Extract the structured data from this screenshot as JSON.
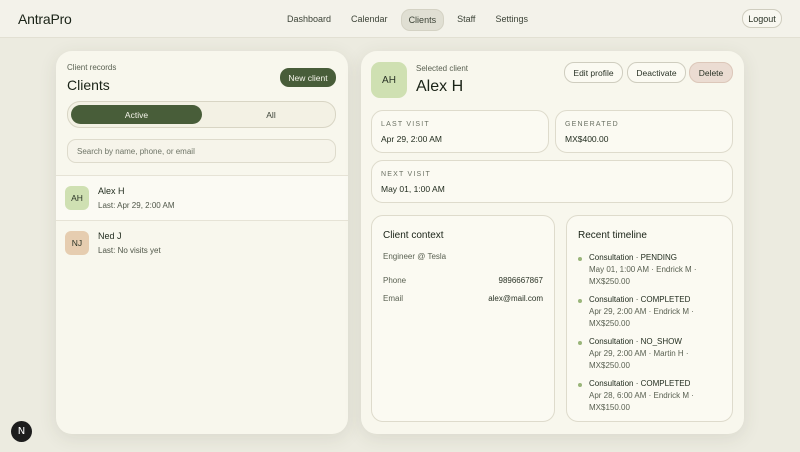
{
  "app": {
    "brand": "AntraPro"
  },
  "nav": {
    "items": [
      {
        "label": "Dashboard"
      },
      {
        "label": "Calendar"
      },
      {
        "label": "Clients",
        "active": true
      },
      {
        "label": "Staff"
      },
      {
        "label": "Settings"
      }
    ],
    "logout": "Logout"
  },
  "list": {
    "eyebrow": "Client records",
    "title": "Clients",
    "new_button": "New client",
    "tabs": {
      "active": "Active",
      "all": "All"
    },
    "search_placeholder": "Search by name, phone, or email",
    "clients": [
      {
        "initials": "AH",
        "name": "Alex H",
        "last": "Last: Apr 29, 2:00 AM"
      },
      {
        "initials": "NJ",
        "name": "Ned J",
        "last": "Last: No visits yet"
      }
    ]
  },
  "detail": {
    "initials": "AH",
    "eyebrow": "Selected client",
    "name": "Alex H",
    "actions": {
      "edit": "Edit profile",
      "deactivate": "Deactivate",
      "delete": "Delete"
    },
    "stats": {
      "last_visit": {
        "label": "LAST VISIT",
        "value": "Apr 29, 2:00 AM"
      },
      "generated": {
        "label": "GENERATED",
        "value": "MX$400.00"
      },
      "next_visit": {
        "label": "NEXT VISIT",
        "value": "May 01, 1:00 AM"
      }
    },
    "context": {
      "title": "Client context",
      "occupation": "Engineer @ Tesla",
      "phone_label": "Phone",
      "phone": "9896667867",
      "email_label": "Email",
      "email": "alex@mail.com"
    },
    "timeline": {
      "title": "Recent timeline",
      "items": [
        {
          "head": "Consultation · PENDING",
          "sub": "May 01, 1:00 AM · Endrick M · MX$250.00"
        },
        {
          "head": "Consultation · COMPLETED",
          "sub": "Apr 29, 2:00 AM · Endrick M · MX$250.00"
        },
        {
          "head": "Consultation · NO_SHOW",
          "sub": "Apr 29, 2:00 AM · Martin H · MX$250.00"
        },
        {
          "head": "Consultation · COMPLETED",
          "sub": "Apr 28, 6:00 AM · Endrick M · MX$150.00"
        }
      ]
    }
  },
  "dev_badge": "N",
  "colors": {
    "accent": "#485d39",
    "avatar_green": "#cfe0b2",
    "avatar_tan": "#e6cdb0",
    "delete_bg": "#ebdcd2"
  }
}
